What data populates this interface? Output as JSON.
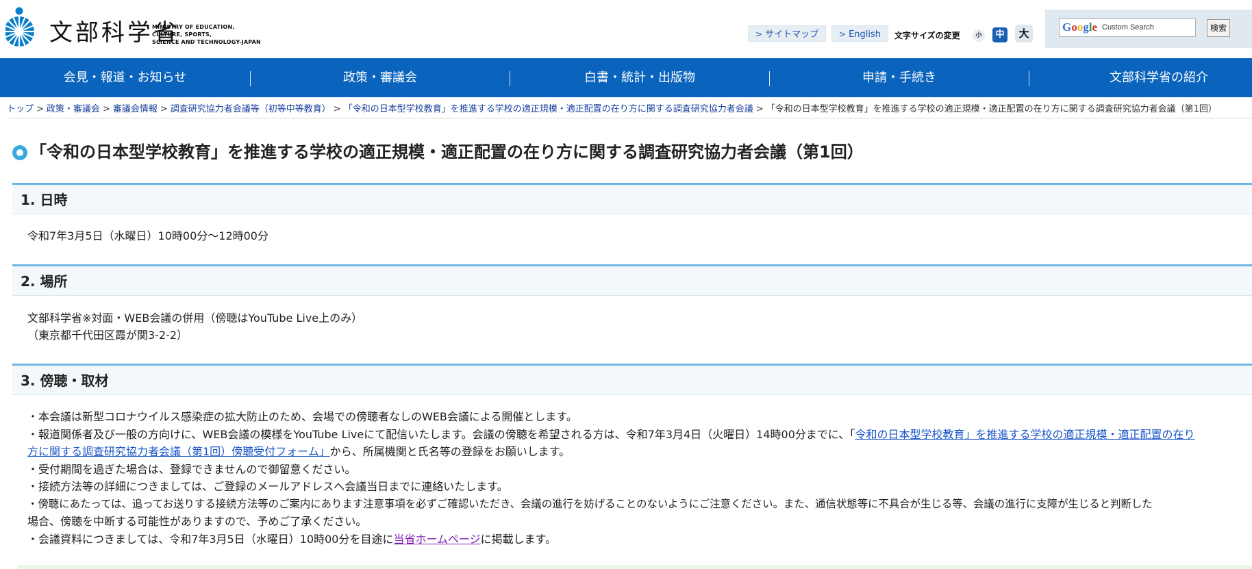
{
  "header": {
    "logo_text": "文部科学省",
    "logo_en": [
      "MINISTRY OF EDUCATION,",
      "CULTURE, SPORTS,",
      "SCIENCE AND TECHNOLOGY-JAPAN"
    ],
    "sitemap": "サイトマップ",
    "english": "English",
    "font_size_label": "文字サイズの変更",
    "font_small": "小",
    "font_mid": "中",
    "font_big": "大",
    "search_brand": "Google",
    "search_placeholder": "Custom Search",
    "search_button": "検索"
  },
  "nav": [
    "会見・報道・お知らせ",
    "政策・審議会",
    "白書・統計・出版物",
    "申請・手続き",
    "文部科学省の紹介"
  ],
  "breadcrumb": {
    "links": [
      "トップ",
      "政策・審議会",
      "審議会情報",
      "調査研究協力者会議等（初等中等教育）",
      "「令和の日本型学校教育」を推進する学校の適正規模・適正配置の在り方に関する調査研究協力者会議"
    ],
    "current": "「令和の日本型学校教育」を推進する学校の適正規模・適正配置の在り方に関する調査研究協力者会議（第1回）"
  },
  "title": "「令和の日本型学校教育」を推進する学校の適正規模・適正配置の在り方に関する調査研究協力者会議（第1回）",
  "sections": {
    "s1": {
      "heading": "1. 日時",
      "text": "令和7年3月5日（水曜日）10時00分～12時00分"
    },
    "s2": {
      "heading": "2. 場所",
      "line1": "文部科学省※対面・WEB会議の併用（傍聴はYouTube Live上のみ）",
      "line2": "（東京都千代田区霞が関3-2-2）"
    },
    "s3": {
      "heading": "3. 傍聴・取材",
      "b1": "・本会議は新型コロナウイルス感染症の拡大防止のため、会場での傍聴者なしのWEB会議による開催とします。",
      "b2_pre": "・報道関係者及び一般の方向けに、WEB会議の模様をYouTube Liveにて配信いたします。会議の傍聴を希望される方は、令和7年3月4日（火曜日）14時00分までに、「",
      "b2_link_a": "令和の日本型学校教育」を推進する学校の適正規模・適正配置の在り",
      "b2_link_b": "方に関する調査研究協力者会議（第1回）傍聴受付フォーム」",
      "b2_post": "から、所属機関と氏名等の登録をお願いします。",
      "b3": "・受付期間を過ぎた場合は、登録できませんので御留意ください。",
      "b4": "・接続方法等の詳細につきましては、ご登録のメールアドレスへ会議当日までに連絡いたします。",
      "b5a": "・傍聴にあたっては、追ってお送りする接続方法等のご案内にあります注意事項を必ずご確認いただき、会議の進行を妨げることのないようにご注意ください。また、通信状態等に不具合が生じる等、会議の進行に支障が生じると判断した",
      "b5b": "場合、傍聴を中断する可能性がありますので、予めご了承ください。",
      "b6_pre": "・会議資料につきましては、令和7年3月5日（水曜日）10時00分を目途に",
      "b6_link": "当省ホームページ",
      "b6_post": "に掲載します。"
    }
  },
  "colors": {
    "nav": "#0a64bd",
    "accent": "#39a9de",
    "link": "#1a55c8"
  }
}
